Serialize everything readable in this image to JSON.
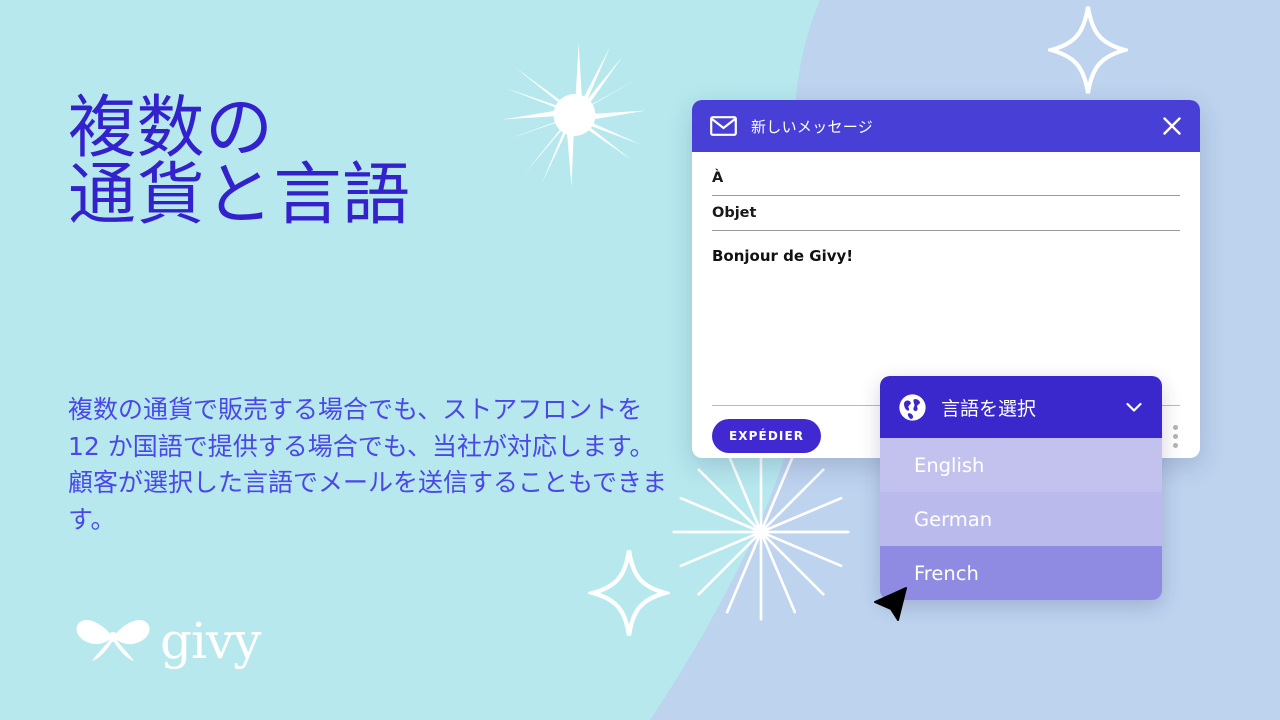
{
  "slide": {
    "headline": "複数の\n通貨と言語",
    "body": "複数の通貨で販売する場合でも、ストアフロントを 12 か国語で提供する場合でも、当社が対応します。 顧客が選択した言語でメールを送信することもできます。",
    "brand_name": "givy",
    "colors": {
      "background": "#b6e8ee",
      "blob": "#bdd3ee",
      "heading": "#3322cc",
      "body_text": "#4b47e8",
      "accent_purple": "#4840d6",
      "dropdown_header": "#3a28cc",
      "item_english": "#c3c2ef",
      "item_german": "#bbbaed",
      "item_french": "#8f8ae2"
    }
  },
  "compose": {
    "icon": "envelope-icon",
    "title": "新しいメッセージ",
    "close_icon": "close-icon",
    "fields": [
      {
        "label": "À",
        "value": ""
      },
      {
        "label": "Objet",
        "value": ""
      }
    ],
    "message_body": "Bonjour de Givy!",
    "send_label": "EXPÉDIER",
    "more_icon": "kebab-menu-icon"
  },
  "language_dropdown": {
    "icon": "globe-icon",
    "title": "言語を選択",
    "chevron_icon": "chevron-down-icon",
    "options": [
      {
        "label": "English",
        "state": "normal"
      },
      {
        "label": "German",
        "state": "normal"
      },
      {
        "label": "French",
        "state": "selected"
      }
    ]
  },
  "decorations": {
    "starburst_icon": "starburst-sparkle-icon",
    "ray_burst_icon": "ray-burst-sparkle-icon",
    "four_point_star_icon": "four-point-star-icon",
    "cursor_icon": "mouse-cursor-icon"
  }
}
